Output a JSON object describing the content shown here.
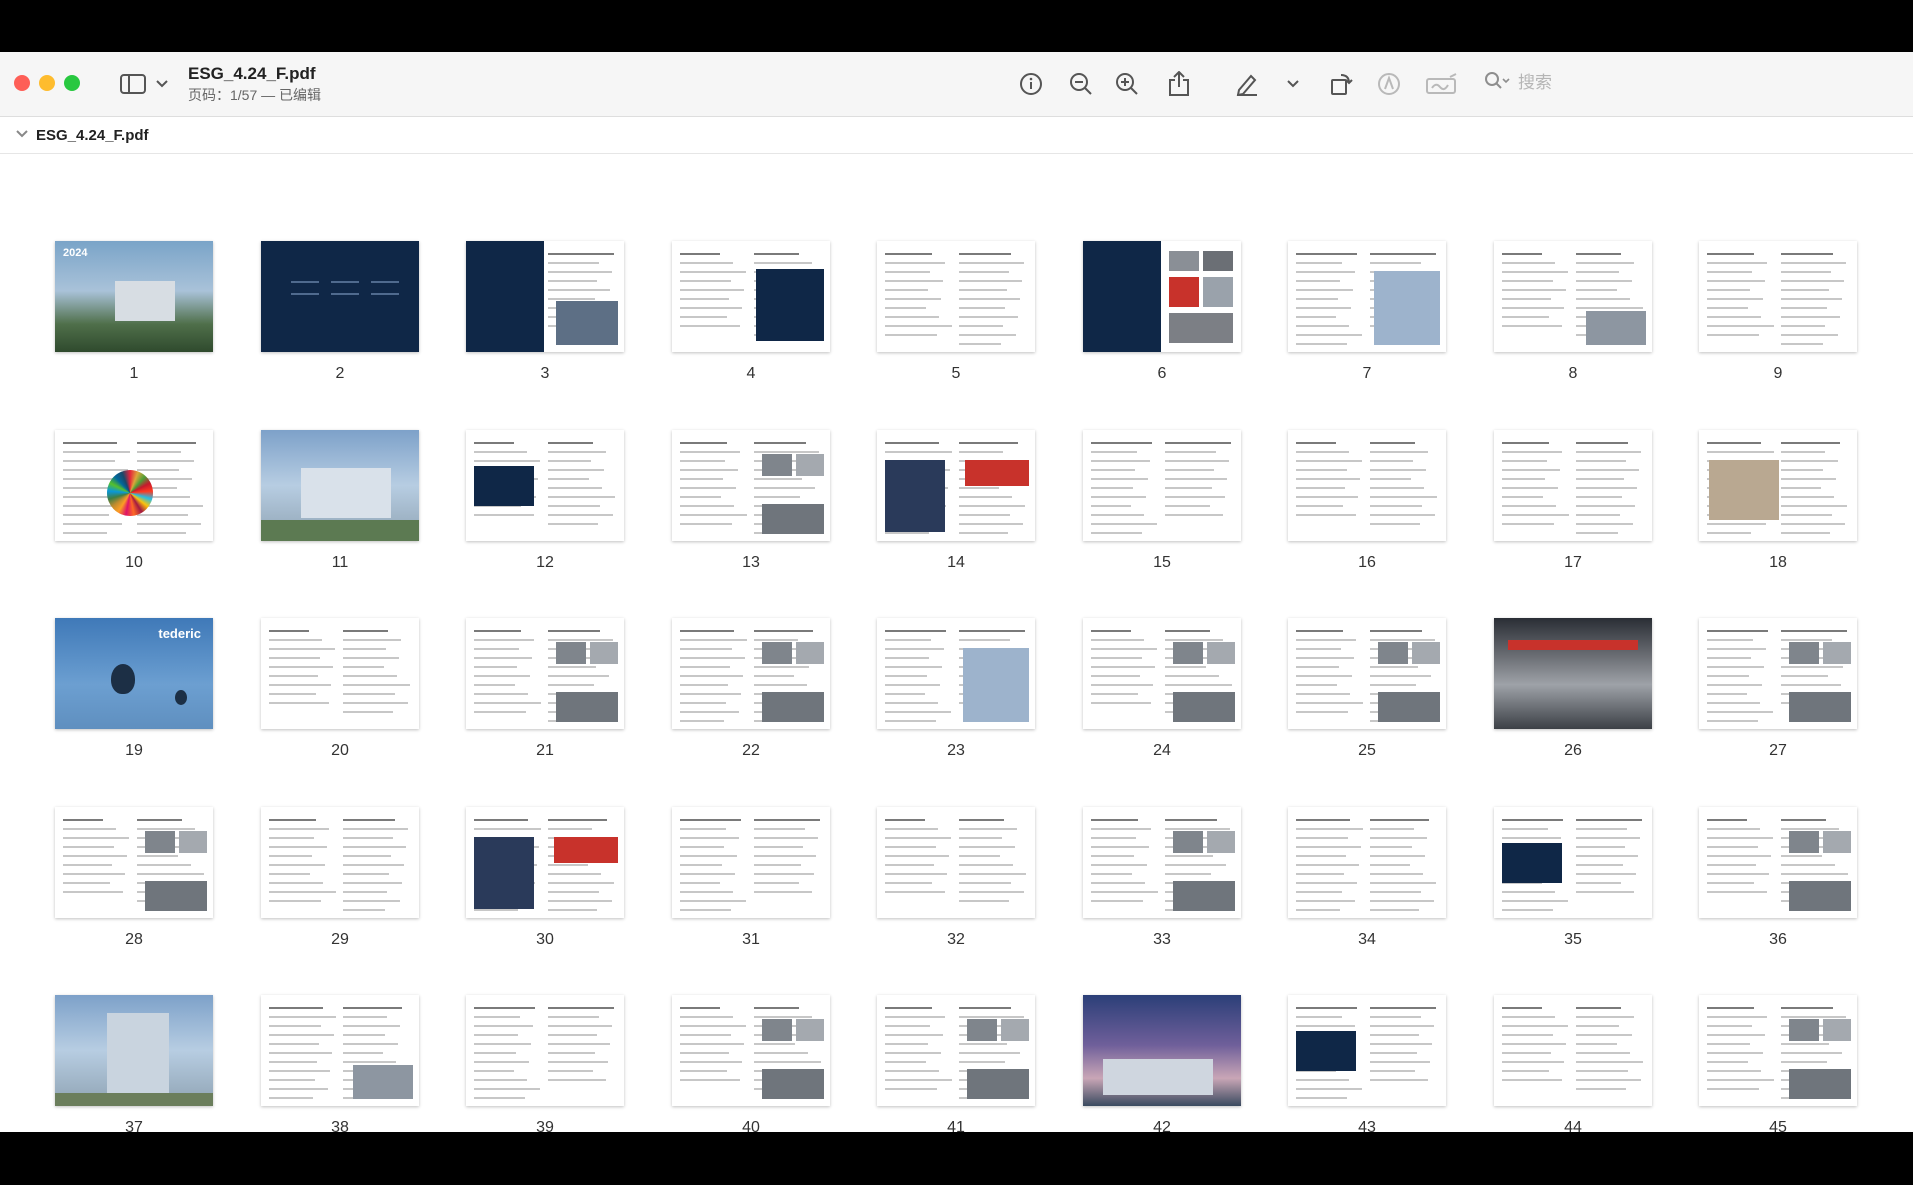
{
  "window": {
    "title": "ESG_4.24_F.pdf",
    "subtitle": "页码：1/57 — 已编辑"
  },
  "toolbar": {
    "icons": [
      "sidebar-icon",
      "chevron-down-icon",
      "info-icon",
      "zoom-out-icon",
      "zoom-in-icon",
      "share-icon",
      "markup-pen-icon",
      "chevron-down-icon",
      "rotate-icon",
      "highlight-icon",
      "signature-icon",
      "search-icon"
    ],
    "search_placeholder": "搜索"
  },
  "outline": {
    "filename": "ESG_4.24_F.pdf"
  },
  "pages": [
    {
      "num": "1",
      "style": "cover",
      "cover_year": "2024"
    },
    {
      "num": "2",
      "style": "dark"
    },
    {
      "num": "3",
      "style": "dark-half"
    },
    {
      "num": "4",
      "style": "doc-right-dark"
    },
    {
      "num": "5",
      "style": "doc"
    },
    {
      "num": "6",
      "style": "dark-left-photos"
    },
    {
      "num": "7",
      "style": "doc-building"
    },
    {
      "num": "8",
      "style": "doc-icons"
    },
    {
      "num": "9",
      "style": "doc"
    },
    {
      "num": "10",
      "style": "doc-wheel"
    },
    {
      "num": "11",
      "style": "building"
    },
    {
      "num": "12",
      "style": "doc-dark-box"
    },
    {
      "num": "13",
      "style": "doc-photos"
    },
    {
      "num": "14",
      "style": "doc-photos-red"
    },
    {
      "num": "15",
      "style": "doc"
    },
    {
      "num": "16",
      "style": "doc"
    },
    {
      "num": "17",
      "style": "doc"
    },
    {
      "num": "18",
      "style": "doc-photo"
    },
    {
      "num": "19",
      "style": "balloons",
      "brand": "tederic"
    },
    {
      "num": "20",
      "style": "doc"
    },
    {
      "num": "21",
      "style": "doc-photos"
    },
    {
      "num": "22",
      "style": "doc-photos"
    },
    {
      "num": "23",
      "style": "doc-building"
    },
    {
      "num": "24",
      "style": "doc-photos"
    },
    {
      "num": "25",
      "style": "doc-photos"
    },
    {
      "num": "26",
      "style": "industrial"
    },
    {
      "num": "27",
      "style": "doc-photos"
    },
    {
      "num": "28",
      "style": "doc-photos"
    },
    {
      "num": "29",
      "style": "doc"
    },
    {
      "num": "30",
      "style": "doc-photos-red"
    },
    {
      "num": "31",
      "style": "doc"
    },
    {
      "num": "32",
      "style": "doc"
    },
    {
      "num": "33",
      "style": "doc-photos"
    },
    {
      "num": "34",
      "style": "doc"
    },
    {
      "num": "35",
      "style": "doc-dark-box"
    },
    {
      "num": "36",
      "style": "doc-photos"
    },
    {
      "num": "37",
      "style": "tower"
    },
    {
      "num": "38",
      "style": "doc-icons"
    },
    {
      "num": "39",
      "style": "doc"
    },
    {
      "num": "40",
      "style": "doc-photos"
    },
    {
      "num": "41",
      "style": "doc-photos"
    },
    {
      "num": "42",
      "style": "dusk"
    },
    {
      "num": "43",
      "style": "doc-dark-box"
    },
    {
      "num": "44",
      "style": "doc"
    },
    {
      "num": "45",
      "style": "doc-photos"
    }
  ],
  "colors": {
    "accent_red": "#c8322b",
    "navy": "#0f2747"
  }
}
